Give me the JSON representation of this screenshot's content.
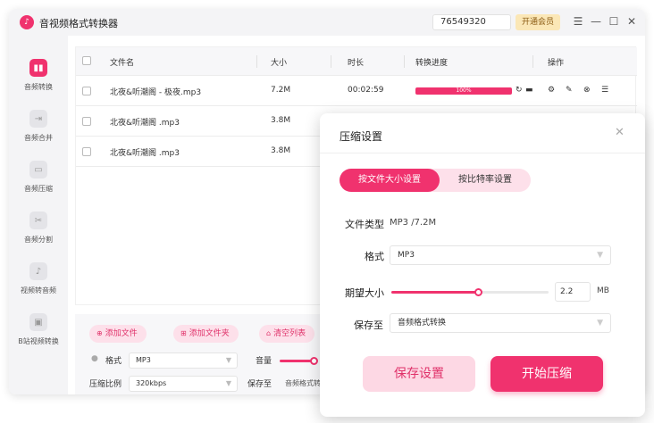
{
  "app": {
    "title": "音视频格式转换器",
    "user_id": "76549320",
    "vip_label": "开通会员"
  },
  "window_controls": {
    "menu": "☰",
    "minimize": "—",
    "maximize": "☐",
    "close": "✕"
  },
  "sidebar": {
    "items": [
      {
        "label": "音频转换",
        "icon": "audio-convert-icon",
        "glyph": "▮▮"
      },
      {
        "label": "音频合并",
        "icon": "audio-merge-icon",
        "glyph": "⇥"
      },
      {
        "label": "音频压缩",
        "icon": "audio-compress-icon",
        "glyph": "▭"
      },
      {
        "label": "音频分割",
        "icon": "audio-split-icon",
        "glyph": "✂"
      },
      {
        "label": "视频转音频",
        "icon": "video-to-audio-icon",
        "glyph": "♪"
      },
      {
        "label": "B站视频转换",
        "icon": "bilibili-convert-icon",
        "glyph": "▣"
      }
    ]
  },
  "table": {
    "headers": {
      "name": "文件名",
      "size": "大小",
      "duration": "时长",
      "progress": "转换进度",
      "actions": "操作"
    },
    "rows": [
      {
        "name": "北夜&听潮阁 - 极夜.mp3",
        "size": "7.2M",
        "duration": "00:02:59",
        "progress_label": "100%",
        "progress": 1.0
      },
      {
        "name": "北夜&听潮阁 .mp3",
        "size": "3.8M"
      },
      {
        "name": "北夜&听潮阁 .mp3",
        "size": "3.8M"
      }
    ]
  },
  "bottom": {
    "add_file": "添加文件",
    "add_folder": "添加文件夹",
    "clear_list": "清空列表",
    "format_label": "格式",
    "format_value": "MP3",
    "volume_label": "音量",
    "ratio_label": "压缩比例",
    "ratio_value": "320kbps",
    "save_to_label": "保存至",
    "save_to_value": "音频格式转换"
  },
  "dialog": {
    "title": "压缩设置",
    "tab_by_size": "按文件大小设置",
    "tab_by_bitrate": "按比特率设置",
    "file_type_label": "文件类型",
    "file_type_value": "MP3 /7.2M",
    "format_label": "格式",
    "format_value": "MP3",
    "size_label": "期望大小",
    "size_value": "2.2",
    "size_unit": "MB",
    "size_fraction": 0.55,
    "save_to_label": "保存至",
    "save_to_value": "音频格式转换",
    "save_button": "保存设置",
    "start_button": "开始压缩"
  },
  "colors": {
    "accent": "#f0326e",
    "accent_light": "#fde0ea",
    "vip": "#fbe7b6"
  }
}
